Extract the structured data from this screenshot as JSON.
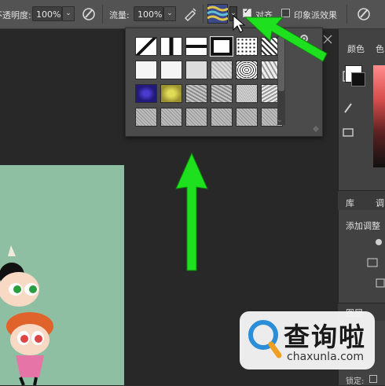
{
  "options_bar": {
    "opacity_label": "不透明度:",
    "opacity_value": "100%",
    "flow_label": "流量:",
    "flow_value": "100%",
    "aligned_label": "对齐",
    "aligned_checked": true,
    "impressionist_label": "印象派效果",
    "impressionist_checked": false
  },
  "pattern_picker": {
    "selected_index": 3,
    "patterns": [
      "diagonal-line",
      "vertical-bar",
      "horizontal-bar",
      "solid-black-frame",
      "dots",
      "wave",
      "white",
      "white",
      "light-gray",
      "gray-texture",
      "square-spiral",
      "crystals",
      "blue-noise",
      "yellow-noise",
      "gray-noise",
      "gray-noise",
      "fine-noise",
      "crumple",
      "gray-speckle",
      "gray-speckle",
      "gray-speckle",
      "gray-speckle",
      "gray-speckle",
      "gray-speckle"
    ]
  },
  "right_panel": {
    "color_tab": "颜色",
    "color_tab2": "色",
    "library_tab": "库",
    "adjust_tab": "调",
    "add_adjustment": "添加调整",
    "layers_tab": "图层",
    "lock_label": "锁定:"
  },
  "watermark": {
    "title": "查询啦",
    "url": "chaxunla.com"
  },
  "colors": {
    "accent_arrow": "#1fe01f",
    "canvas_doc": "#8fbfa3"
  }
}
